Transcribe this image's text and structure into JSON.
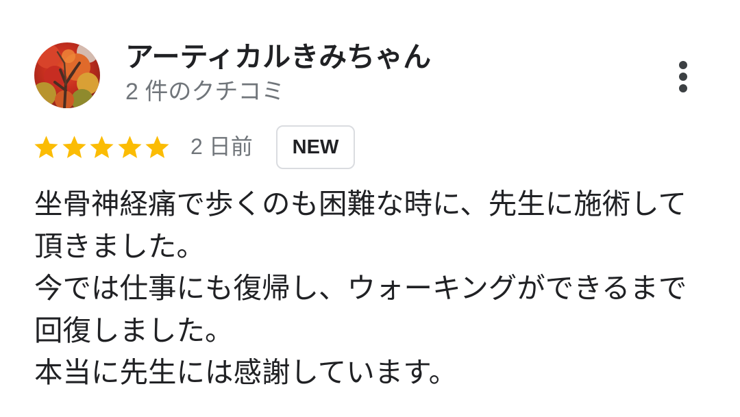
{
  "review": {
    "author_name": "アーティカルきみちゃん",
    "author_review_count": "2 件のクチコミ",
    "rating": 5,
    "date": "2 日前",
    "badge": "NEW",
    "lines": [
      "坐骨神経痛で歩くのも困難な時に、先生に施術して",
      "頂きました。",
      "今では仕事にも復帰し、ウォーキングができるまで",
      "回復しました。",
      "本当に先生には感謝しています。"
    ]
  },
  "icons": {
    "avatar": "autumn-tree-photo",
    "menu": "more-vert-icon",
    "star": "star-icon"
  },
  "colors": {
    "star": "#fbbc04",
    "text": "#202124",
    "secondary_text": "#70757a",
    "badge_border": "#dadce0",
    "background": "#ffffff"
  }
}
